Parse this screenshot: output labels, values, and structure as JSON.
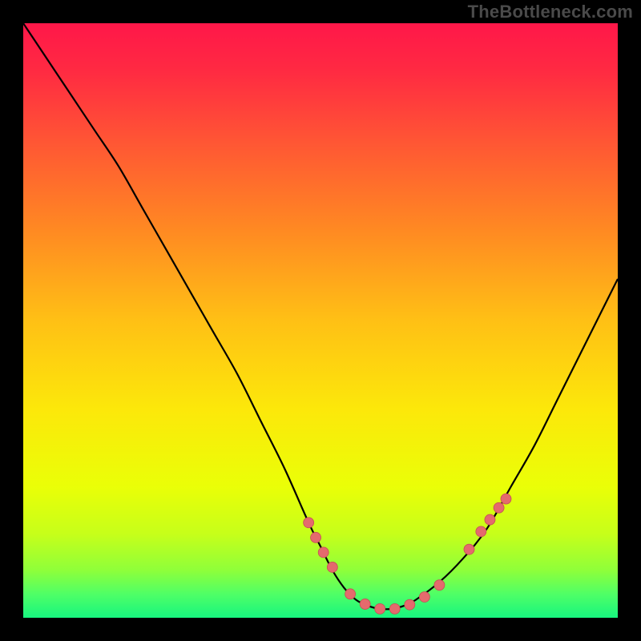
{
  "watermark": "TheBottleneck.com",
  "colors": {
    "frame": "#000000",
    "watermark": "#4a4a4a",
    "curve": "#000000",
    "marker_fill": "#e46a6d",
    "marker_stroke": "#c64f55",
    "gradient_stops": [
      {
        "offset": 0.0,
        "color": "#ff1749"
      },
      {
        "offset": 0.08,
        "color": "#ff2a42"
      },
      {
        "offset": 0.2,
        "color": "#ff5634"
      },
      {
        "offset": 0.35,
        "color": "#ff8a22"
      },
      {
        "offset": 0.5,
        "color": "#ffc015"
      },
      {
        "offset": 0.65,
        "color": "#fce80a"
      },
      {
        "offset": 0.78,
        "color": "#eaff07"
      },
      {
        "offset": 0.86,
        "color": "#c6ff1a"
      },
      {
        "offset": 0.92,
        "color": "#8fff3a"
      },
      {
        "offset": 0.96,
        "color": "#4fff66"
      },
      {
        "offset": 1.0,
        "color": "#17f57f"
      }
    ]
  },
  "chart_data": {
    "type": "line",
    "title": "",
    "xlabel": "",
    "ylabel": "",
    "xlim": [
      0,
      100
    ],
    "ylim": [
      0,
      100
    ],
    "series": [
      {
        "name": "bottleneck-curve",
        "x": [
          0,
          4,
          8,
          12,
          16,
          20,
          24,
          28,
          32,
          36,
          40,
          44,
          48,
          50,
          52,
          54,
          56,
          58,
          60,
          62,
          64,
          66,
          70,
          74,
          78,
          82,
          86,
          90,
          94,
          98,
          100
        ],
        "y": [
          100,
          94,
          88,
          82,
          76,
          69,
          62,
          55,
          48,
          41,
          33,
          25,
          16,
          12,
          8,
          5,
          3,
          2,
          1.5,
          1.5,
          2,
          3,
          6,
          10,
          15,
          22,
          29,
          37,
          45,
          53,
          57
        ]
      }
    ],
    "markers": {
      "name": "highlight-points",
      "x": [
        48.0,
        49.2,
        50.5,
        52.0,
        55.0,
        57.5,
        60.0,
        62.5,
        65.0,
        67.5,
        70.0,
        75.0,
        77.0,
        78.5,
        80.0,
        81.2
      ],
      "y": [
        16.0,
        13.5,
        11.0,
        8.5,
        4.0,
        2.3,
        1.5,
        1.5,
        2.2,
        3.5,
        5.5,
        11.5,
        14.5,
        16.5,
        18.5,
        20.0
      ]
    }
  }
}
